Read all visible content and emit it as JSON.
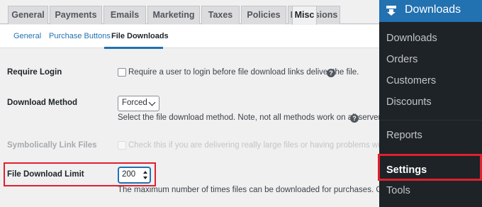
{
  "tabs": [
    "General",
    "Payments",
    "Emails",
    "Marketing",
    "Taxes",
    "Policies",
    "Extensions",
    "Misc"
  ],
  "subtabs": [
    "General",
    "Purchase Buttons",
    "File Downloads"
  ],
  "fields": {
    "require_login": {
      "label": "Require Login",
      "description": "Require a user to login before file download links deliver the file."
    },
    "download_method": {
      "label": "Download Method",
      "selected": "Forced",
      "description": "Select the file download method. Note, not all methods work on all servers."
    },
    "symbolic_link": {
      "label": "Symbolically Link Files",
      "description": "Check this if you are delivering really large files or having problems with file downl"
    },
    "download_limit": {
      "label": "File Download Limit",
      "value": "200",
      "description": "The maximum number of times files can be downloaded for purchases. Can be overw"
    }
  },
  "help_glyph": "?",
  "sidebar": {
    "header": "Downloads",
    "items": [
      "Downloads",
      "Orders",
      "Customers",
      "Discounts",
      "Reports",
      "Settings",
      "Tools"
    ],
    "current": "Settings"
  },
  "colors": {
    "accent": "#2271b1",
    "highlight_box": "#e0202e",
    "sidebar_bg": "#1d2327"
  }
}
